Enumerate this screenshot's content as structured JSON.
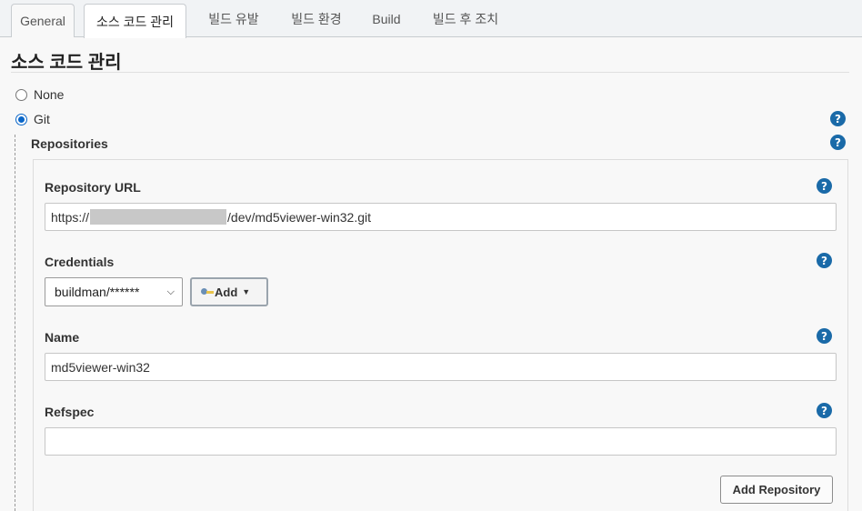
{
  "tabs": [
    {
      "label": "General"
    },
    {
      "label": "소스 코드 관리"
    },
    {
      "label": "빌드 유발"
    },
    {
      "label": "빌드 환경"
    },
    {
      "label": "Build"
    },
    {
      "label": "빌드 후 조치"
    }
  ],
  "active_tab": "소스 코드 관리",
  "section": {
    "title": "소스 코드 관리"
  },
  "scm_options": [
    {
      "label": "None",
      "checked": false
    },
    {
      "label": "Git",
      "checked": true
    }
  ],
  "repositories": {
    "label": "Repositories",
    "url": {
      "label": "Repository URL",
      "value_prefix": "https://",
      "value_suffix": "/dev/md5viewer-win32.git"
    },
    "credentials": {
      "label": "Credentials",
      "selected": "buildman/******",
      "add_label": "Add"
    },
    "name": {
      "label": "Name",
      "value": "md5viewer-win32"
    },
    "refspec": {
      "label": "Refspec",
      "value": ""
    },
    "add_repository_label": "Add Repository"
  },
  "help_glyph": "?",
  "colors": {
    "help_icon": "#1a6aa8",
    "radio_checked": "#0a66c8"
  }
}
